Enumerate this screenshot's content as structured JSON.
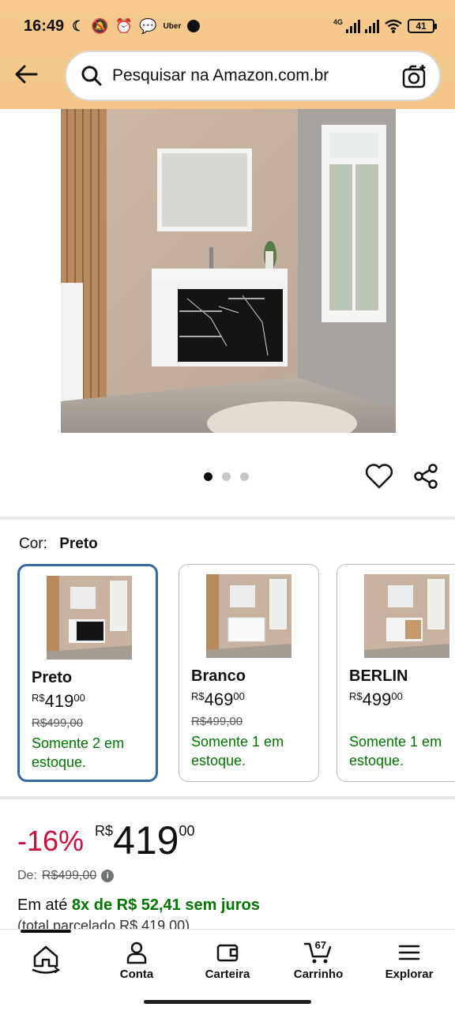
{
  "status_bar": {
    "time": "16:49",
    "uber_label": "Uber",
    "network": "4G",
    "battery": "41"
  },
  "search": {
    "placeholder": "Pesquisar na Amazon.com.br"
  },
  "product_image": {
    "alt": "Banheiro com gabinete suspenso preto marmorizado",
    "carousel_total": 3,
    "carousel_active": 1
  },
  "color_selector": {
    "label": "Cor:",
    "selected": "Preto"
  },
  "variants": [
    {
      "name": "Preto",
      "currency": "R$",
      "price_int": "419",
      "price_cents": "00",
      "old_price": "R$499,00",
      "stock": "Somente 2 em estoque.",
      "selected": true
    },
    {
      "name": "Branco",
      "currency": "R$",
      "price_int": "469",
      "price_cents": "00",
      "old_price": "R$499,00",
      "stock": "Somente 1 em estoque.",
      "selected": false
    },
    {
      "name": "BERLIN",
      "currency": "R$",
      "price_int": "499",
      "price_cents": "00",
      "old_price": "",
      "stock": "Somente 1 em estoque.",
      "selected": false
    }
  ],
  "price": {
    "discount": "-16%",
    "currency": "R$",
    "int": "419",
    "cents": "00",
    "de_label": "De:",
    "de_value": "R$499,00",
    "installments_prefix": "Em até",
    "installments_value": "8x de R$ 52,41 sem juros",
    "total_text": "(total parcelado R$ 419,00)"
  },
  "bottom_nav": {
    "home": "",
    "conta": "Conta",
    "carteira": "Carteira",
    "carrinho": "Carrinho",
    "cart_count": "67",
    "explorar": "Explorar"
  },
  "colors": {
    "header_bg": "#f7c98d",
    "selected_border": "#2f6aa3",
    "discount_red": "#cc0c39",
    "stock_green": "#007600"
  }
}
